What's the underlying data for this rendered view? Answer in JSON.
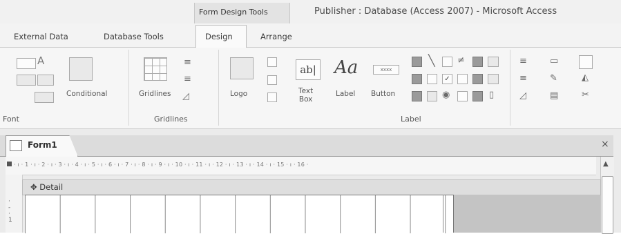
{
  "title_bar": {
    "context_group": "Form Design Tools",
    "app_title": "Publisher : Database (Access 2007) - Microsoft Access"
  },
  "tabs": [
    {
      "label": "External Data"
    },
    {
      "label": "Database Tools"
    },
    {
      "label": "Design"
    },
    {
      "label": "Arrange"
    }
  ],
  "ribbon": {
    "font_group": {
      "label": "Font"
    },
    "conditional": {
      "label": "Conditional"
    },
    "gridlines_group": {
      "label": "Gridlines",
      "button_label": "Gridlines"
    },
    "controls_group": {
      "label": "Label",
      "logo": "Logo",
      "text_box": "Text\nBox",
      "text_box_icon": "ab|",
      "label_icon": "Aa",
      "button": "Button",
      "button_icon": "xxxx"
    }
  },
  "document": {
    "tab_label": "Form1",
    "close_glyph": "×",
    "ruler_text": "· ı · 1 · ı · 2 · ı · 3 · ı · 4 · ı · 5 · ı · 6 · ı · 7 · ı · 8 · ı · 9 · ı · 10 · ı · 11 · ı · 12 · ı · 13 · ı · 14 · ı · 15 · ı · 16 ·",
    "section_label": "Detail",
    "section_glyph": "✥",
    "vertical_ruler": "·\n-\n·\n1"
  },
  "icons": {
    "gridlines_icon": "grid",
    "logo_icon": "image",
    "line_icon": "line",
    "rect_icon": "rectangle",
    "check_icon": "checkbox",
    "option_icon": "radio",
    "scroll_up": "▲"
  }
}
